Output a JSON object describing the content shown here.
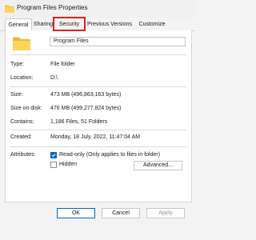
{
  "window": {
    "title": "Program Files Properties",
    "title_icon": "folder-icon"
  },
  "tabs": [
    {
      "label": "General",
      "active": true
    },
    {
      "label": "Sharing",
      "active": false
    },
    {
      "label": "Security",
      "active": false,
      "highlighted": true
    },
    {
      "label": "Previous Versions",
      "active": false
    },
    {
      "label": "Customize",
      "active": false
    }
  ],
  "general": {
    "folder_name": "Program Files",
    "rows": [
      {
        "label": "Type:",
        "value": "File folder"
      },
      {
        "label": "Location:",
        "value": "D:\\"
      },
      {
        "label": "Size:",
        "value": "473 MB (496,863,163 bytes)"
      },
      {
        "label": "Size on disk:",
        "value": "476 MB (499,277,824 bytes)"
      },
      {
        "label": "Contains:",
        "value": "1,186 Files, 51 Folders"
      },
      {
        "label": "Created:",
        "value": "Monday, 18 July, 2022, 11:47:04 AM"
      }
    ],
    "attributes_label": "Attributes:",
    "readonly_label": "Read-only (Only applies to files in folder)",
    "readonly_checked": true,
    "hidden_label": "Hidden",
    "hidden_checked": false,
    "advanced_label": "Advanced..."
  },
  "buttons": {
    "ok": "OK",
    "cancel": "Cancel",
    "apply": "Apply"
  },
  "colors": {
    "accent": "#0067c0",
    "highlight": "#e0211d",
    "folder": "#f4c542"
  }
}
